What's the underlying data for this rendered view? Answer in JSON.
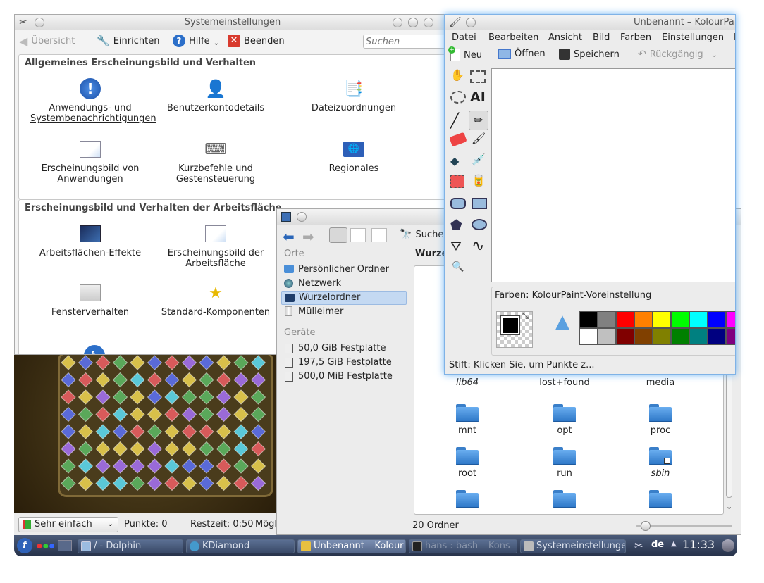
{
  "sysettings": {
    "title": "Systemeinstellungen",
    "toolbar": {
      "overview": "Übersicht",
      "configure": "Einrichten",
      "help": "Hilfe",
      "quit": "Beenden",
      "search_placeholder": "Suchen"
    },
    "group1_title": "Allgemeines Erscheinungsbild und Verhalten",
    "group1_items": [
      {
        "label1": "Anwendungs- und",
        "label2": "Systembenachrichtigungen"
      },
      {
        "label1": "Benutzerkontodetails",
        "label2": ""
      },
      {
        "label1": "Dateizuordnungen",
        "label2": ""
      },
      {
        "label1": "Erscheinungsbild von",
        "label2": "Anwendungen"
      },
      {
        "label1": "Kurzbefehle und",
        "label2": "Gestensteuerung"
      },
      {
        "label1": "Regionales",
        "label2": ""
      }
    ],
    "group2_title": "Erscheinungsbild und Verhalten der Arbeitsfläche",
    "group2_items": [
      {
        "label1": "Arbeitsflächen-Effekte",
        "label2": ""
      },
      {
        "label1": "Erscheinungsbild der",
        "label2": "Arbeitsfläche"
      },
      {
        "label1": "Fensterverhalten",
        "label2": ""
      },
      {
        "label1": "Standard-Komponenten",
        "label2": ""
      }
    ]
  },
  "kdiamond": {
    "difficulty": "Sehr einfach",
    "points_label": "Punkte: 0",
    "time_label": "Restzeit: 0:50",
    "moves_label": "Mögliche"
  },
  "dolphin": {
    "search": "Suche",
    "places_header": "Orte",
    "places": [
      "Persönlicher Ordner",
      "Netzwerk",
      "Wurzelordner",
      "Mülleimer"
    ],
    "devices_header": "Geräte",
    "devices": [
      "50,0 GiB Festplatte",
      "197,5 GiB Festplatte",
      "500,0 MiB Festplatte"
    ],
    "location": "Wurze",
    "folders": [
      "lib64",
      "lost+found",
      "media",
      "mnt",
      "opt",
      "proc",
      "root",
      "run",
      "sbin"
    ],
    "status": "20 Ordner"
  },
  "kolourpaint": {
    "title": "Unbenannt – KolourPaint",
    "menu": [
      "Datei",
      "Bearbeiten",
      "Ansicht",
      "Bild",
      "Farben",
      "Einstellungen",
      "H"
    ],
    "toolbar": {
      "new": "Neu",
      "open": "Öffnen",
      "save": "Speichern",
      "undo": "Rückgängig"
    },
    "palette_title": "Farben: KolourPaint-Voreinstellung",
    "status": "Stift: Klicken Sie, um Punkte z...",
    "palette_row1": [
      "#000000",
      "#808080",
      "#ff0000",
      "#ff8000",
      "#ffff00",
      "#00ff00",
      "#00ffff",
      "#0000ff",
      "#ff00ff"
    ],
    "palette_row2": [
      "#ffffff",
      "#c0c0c0",
      "#800000",
      "#804000",
      "#808000",
      "#008000",
      "#008080",
      "#000080",
      "#800080"
    ]
  },
  "taskbar": {
    "tasks": [
      "/ - Dolphin",
      "KDiamond",
      "Unbenannt – Kolour",
      "hans : bash – Kons",
      "Systemeinstellunge"
    ],
    "keyboard_layout": "de",
    "clock": "11:33"
  }
}
